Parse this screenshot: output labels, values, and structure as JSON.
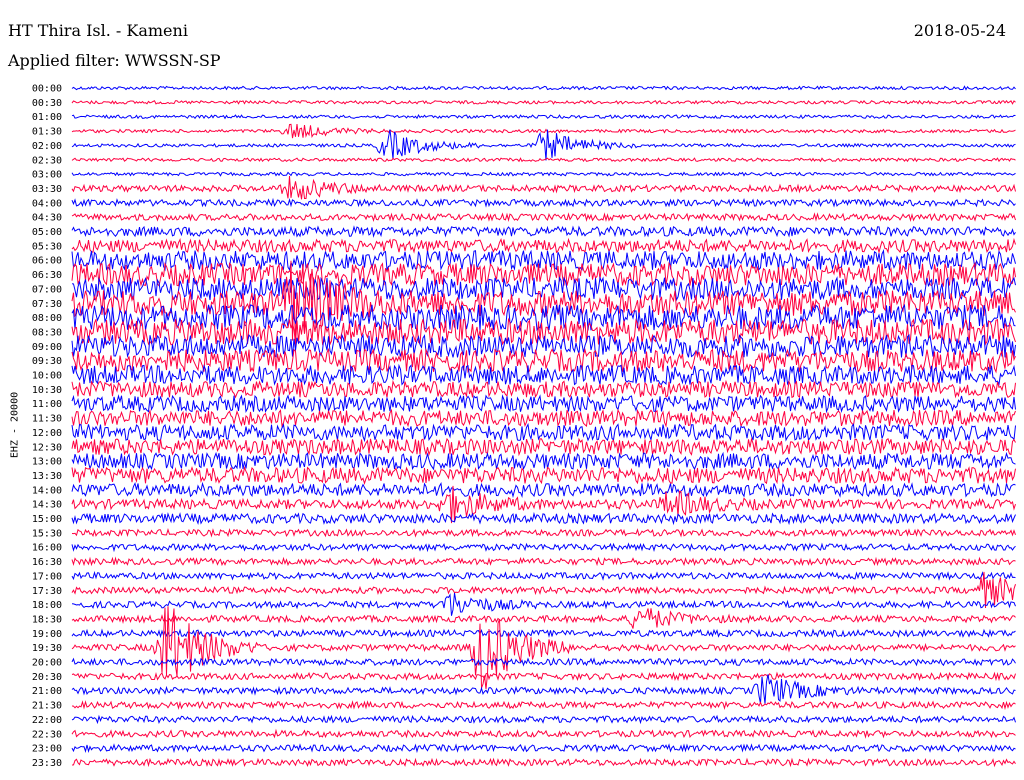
{
  "header": {
    "station": "HT Thira Isl. - Kameni",
    "date": "2018-05-24",
    "filter": "Applied filter: WWSSN-SP"
  },
  "chart_data": {
    "type": "line",
    "title": "HT Thira Isl. - Kameni",
    "ylabel": "EHZ - 20000",
    "row_labels": [
      "00:00",
      "00:30",
      "01:00",
      "01:30",
      "02:00",
      "02:30",
      "03:00",
      "03:30",
      "04:00",
      "04:30",
      "05:00",
      "05:30",
      "06:00",
      "06:30",
      "07:00",
      "07:30",
      "08:00",
      "08:30",
      "09:00",
      "09:30",
      "10:00",
      "10:30",
      "11:00",
      "11:30",
      "12:00",
      "12:30",
      "13:00",
      "13:30",
      "14:00",
      "14:30",
      "15:00",
      "15:30",
      "16:00",
      "16:30",
      "17:00",
      "17:30",
      "18:00",
      "18:30",
      "19:00",
      "19:30",
      "20:00",
      "20:30",
      "21:00",
      "21:30",
      "22:00",
      "22:30",
      "23:00",
      "23:30"
    ],
    "trace_colors": [
      "#0000ff",
      "#ff0040"
    ],
    "relative_amplitude": [
      1,
      1,
      1,
      1,
      1,
      1,
      1,
      2,
      2,
      2,
      3,
      4,
      6,
      7,
      7,
      8,
      8,
      8,
      7,
      7,
      6,
      5,
      5,
      5,
      5,
      5,
      5,
      5,
      4,
      3,
      3,
      2,
      2,
      2,
      2,
      2,
      2,
      2,
      2,
      2,
      2,
      2,
      2,
      2,
      2,
      2,
      2,
      2
    ],
    "events": [
      {
        "row": "01:30",
        "minute": 7,
        "strength": 2
      },
      {
        "row": "02:00",
        "minute": 10,
        "strength": 4
      },
      {
        "row": "02:00",
        "minute": 15,
        "strength": 4
      },
      {
        "row": "03:30",
        "minute": 7,
        "strength": 3
      },
      {
        "row": "07:30",
        "minute": 7,
        "strength": 10
      },
      {
        "row": "14:30",
        "minute": 12,
        "strength": 4
      },
      {
        "row": "14:30",
        "minute": 19,
        "strength": 3
      },
      {
        "row": "17:30",
        "minute": 29,
        "strength": 4
      },
      {
        "row": "18:00",
        "minute": 12,
        "strength": 3
      },
      {
        "row": "18:30",
        "minute": 18,
        "strength": 3
      },
      {
        "row": "19:30",
        "minute": 3,
        "strength": 12
      },
      {
        "row": "19:30",
        "minute": 13,
        "strength": 12
      },
      {
        "row": "21:00",
        "minute": 22,
        "strength": 4
      }
    ]
  }
}
